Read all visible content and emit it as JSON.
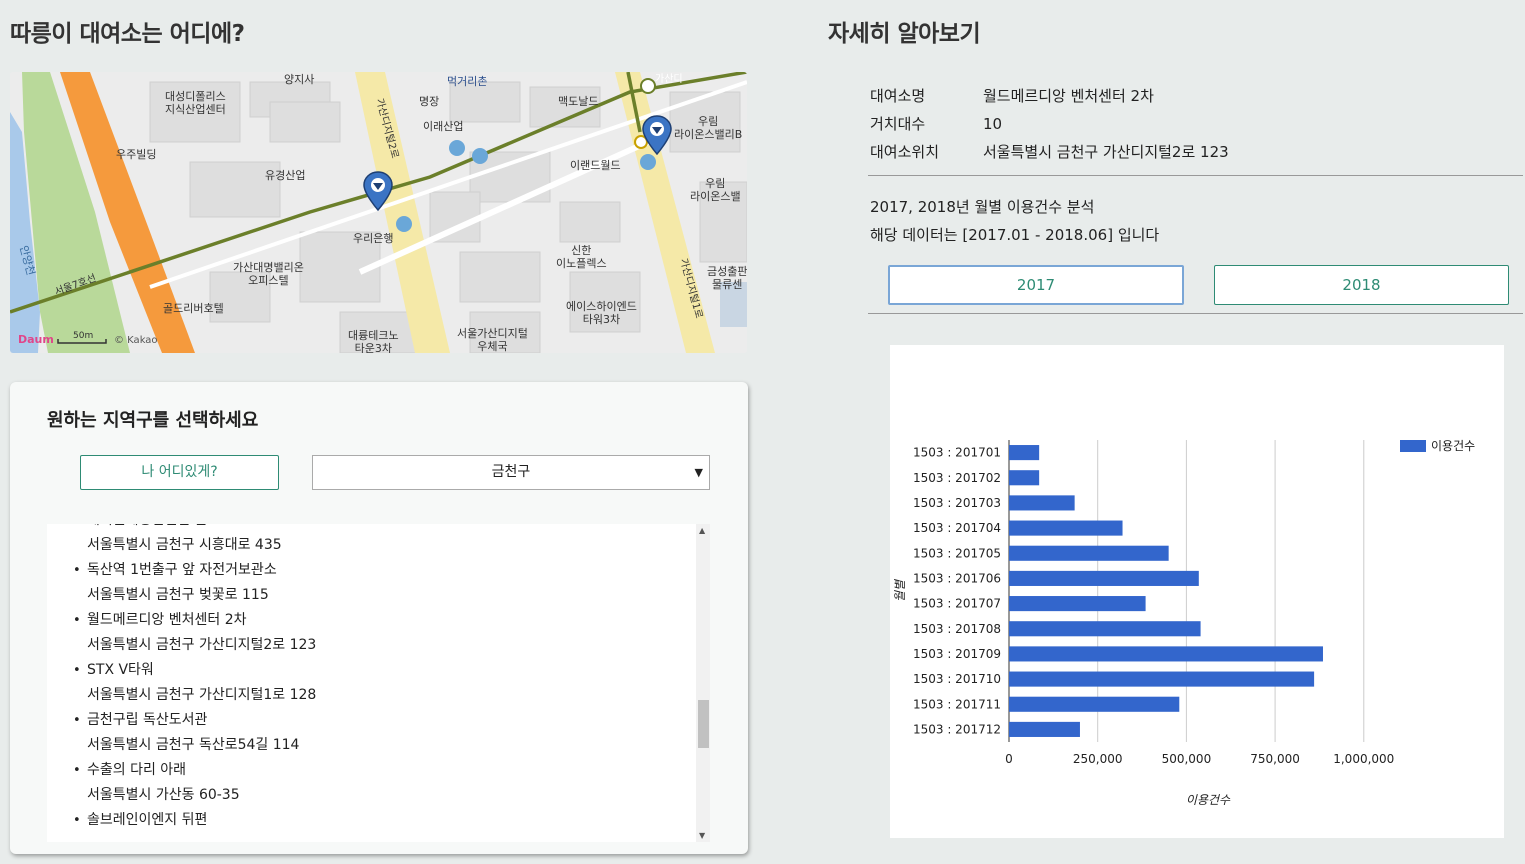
{
  "headings": {
    "where": "따릉이 대여소는 어디에?",
    "details": "자세히 알아보기"
  },
  "map": {
    "labels": [
      "양지사",
      "먹거리촌",
      "명장",
      "맥도날드",
      "대성디폴리스\n지식산업센터",
      "이래산업",
      "우림\n라이온스밸리B",
      "우주빌딩",
      "유경산업",
      "이랜드월드",
      "우림\n라이온스밸",
      "우리은행",
      "가산대명밸리온\n오피스텔",
      "신한\n이노플렉스",
      "금성출판\n물류센",
      "골드리버호텔",
      "에이스하이엔드\n타워3차",
      "대륭테크노\n타운3차",
      "서울가산디지털\n우체국",
      "안양천",
      "서울7호선",
      "가산디지털2로",
      "가산디지털1로",
      "가산디",
      "50m",
      "© Kakao",
      "Daum"
    ],
    "road_colors": {
      "main": "#f5e9a8",
      "orange": "#f59a3d",
      "green": "#b9d99a",
      "river": "#a9c9ea",
      "subway": "#6b7f2a"
    }
  },
  "panel": {
    "title": "원하는 지역구를 선택하세요",
    "locate_button": "나 어디있게?",
    "district_selected": "금천구",
    "stations": [
      {
        "name": "에이원웨딩컨벤션 앞",
        "addr": "서울특별시 금천구 시흥대로 435"
      },
      {
        "name": "독산역 1번출구 앞 자전거보관소",
        "addr": "서울특별시 금천구 벚꽃로 115"
      },
      {
        "name": "월드메르디앙 벤처센터 2차",
        "addr": "서울특별시 금천구 가산디지털2로 123"
      },
      {
        "name": "STX V타워",
        "addr": "서울특별시 금천구 가산디지털1로 128"
      },
      {
        "name": "금천구립 독산도서관",
        "addr": "서울특별시 금천구 독산로54길 114"
      },
      {
        "name": "수출의 다리 아래",
        "addr": "서울특별시 가산동 60-35"
      },
      {
        "name": "솔브레인이엔지 뒤편",
        "addr": ""
      }
    ]
  },
  "details": {
    "rows": [
      {
        "key": "대여소명",
        "value": "월드메르디앙 벤처센터 2차"
      },
      {
        "key": "거치대수",
        "value": "10"
      },
      {
        "key": "대여소위치",
        "value": "서울특별시 금천구 가산디지털2로 123"
      }
    ],
    "analysis_line1": "2017, 2018년 월별 이용건수 분석",
    "analysis_line2": "해당 데이터는 [2017.01 - 2018.06] 입니다",
    "year_2017": "2017",
    "year_2018": "2018"
  },
  "chart_data": {
    "type": "bar",
    "orientation": "horizontal",
    "categories": [
      "1503 : 201701",
      "1503 : 201702",
      "1503 : 201703",
      "1503 : 201704",
      "1503 : 201705",
      "1503 : 201706",
      "1503 : 201707",
      "1503 : 201708",
      "1503 : 201709",
      "1503 : 201710",
      "1503 : 201711",
      "1503 : 201712"
    ],
    "series": [
      {
        "name": "이용건수",
        "values": [
          85000,
          85000,
          185000,
          320000,
          450000,
          535000,
          385000,
          540000,
          885000,
          860000,
          480000,
          200000
        ]
      }
    ],
    "xlabel": "이용건수",
    "ylabel": "월별",
    "xlim": [
      0,
      1150000
    ],
    "xticks": [
      0,
      250000,
      500000,
      750000,
      1000000
    ],
    "xtick_labels": [
      "0",
      "250,000",
      "500,000",
      "750,000",
      "1,000,000"
    ],
    "grid": true,
    "legend": "top-right",
    "bar_color": "#3366cc"
  }
}
